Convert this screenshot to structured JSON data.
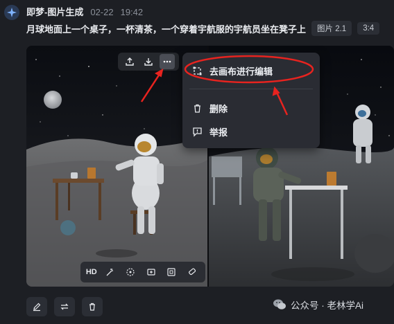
{
  "header": {
    "app_name": "即梦-图片生成",
    "date": "02-22",
    "time": "19:42"
  },
  "prompt": {
    "text": "月球地面上一个桌子，一杯清茶，一个穿着宇航服的宇航员坐在凳子上",
    "model_tag": "图片 2.1",
    "ratio_tag": "3:4"
  },
  "image_toolbar": {
    "icons": [
      "upload-icon",
      "download-icon",
      "more-icon"
    ]
  },
  "bottom_toolbar": {
    "hd_label": "HD",
    "icons": [
      "magic-wand-icon",
      "paint-swirl-icon",
      "expand-image-icon",
      "fullscreen-icon",
      "eraser-icon"
    ]
  },
  "context_menu": {
    "items": [
      {
        "label": "去画布进行编辑",
        "icon": "canvas-edit-icon"
      },
      {
        "label": "删除",
        "icon": "trash-icon"
      },
      {
        "label": "举报",
        "icon": "report-icon"
      }
    ]
  },
  "actions": {
    "icons": [
      "edit-icon",
      "regenerate-icon",
      "delete-icon"
    ]
  },
  "watermark": {
    "text": "公众号 · 老林学Ai"
  },
  "colors": {
    "background": "#1d1f24",
    "menu": "#2a2c33",
    "annotation": "#e8231f"
  }
}
